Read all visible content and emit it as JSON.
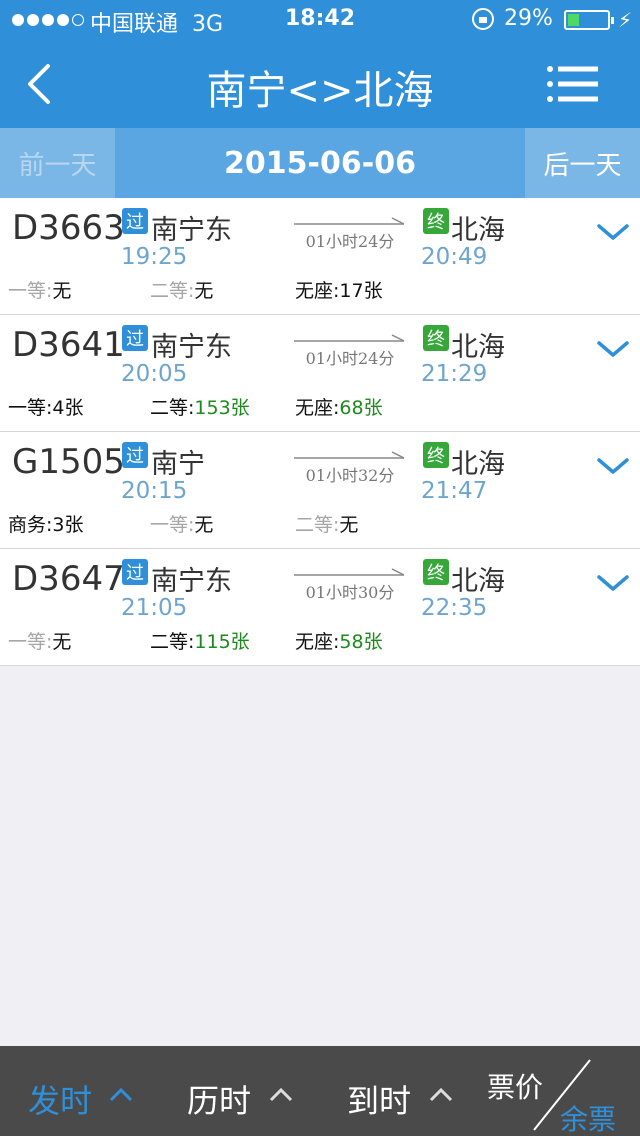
{
  "status_bar": {
    "carrier": "中国联通",
    "network": "3G",
    "time": "18:42",
    "battery_percent": "29%",
    "battery_level": 0.29
  },
  "nav": {
    "title": "南宁<>北海"
  },
  "date_bar": {
    "prev_label": "前一天",
    "date": "2015-06-06",
    "next_label": "后一天"
  },
  "trains": [
    {
      "number": "D3663",
      "pass_badge": "过",
      "from": "南宁东",
      "depart": "19:25",
      "duration": "01小时24分",
      "end_badge": "终",
      "to": "北海",
      "arrive": "20:49",
      "seats": [
        {
          "label": "一等:",
          "value": "无"
        },
        {
          "label": "二等:",
          "value": "无"
        },
        {
          "label": "无座:",
          "value": "17张"
        }
      ]
    },
    {
      "number": "D3641",
      "pass_badge": "过",
      "from": "南宁东",
      "depart": "20:05",
      "duration": "01小时24分",
      "end_badge": "终",
      "to": "北海",
      "arrive": "21:29",
      "seats": [
        {
          "label": "一等:",
          "value": "4张"
        },
        {
          "label": "二等:",
          "value": "153张"
        },
        {
          "label": "无座:",
          "value": "68张"
        }
      ]
    },
    {
      "number": "G1505",
      "pass_badge": "过",
      "from": "南宁",
      "depart": "20:15",
      "duration": "01小时32分",
      "end_badge": "终",
      "to": "北海",
      "arrive": "21:47",
      "seats": [
        {
          "label": "商务:",
          "value": "3张"
        },
        {
          "label": "一等:",
          "value": "无"
        },
        {
          "label": "二等:",
          "value": "无"
        }
      ]
    },
    {
      "number": "D3647",
      "pass_badge": "过",
      "from": "南宁东",
      "depart": "21:05",
      "duration": "01小时30分",
      "end_badge": "终",
      "to": "北海",
      "arrive": "22:35",
      "seats": [
        {
          "label": "一等:",
          "value": "无"
        },
        {
          "label": "二等:",
          "value": "115张"
        },
        {
          "label": "无座:",
          "value": "58张"
        }
      ]
    }
  ],
  "sort_bar": {
    "depart_label": "发时",
    "duration_label": "历时",
    "arrive_label": "到时",
    "price_label": "票价",
    "remaining_label": "余票"
  },
  "colors": {
    "primary": "#2f8fd8",
    "available": "#1d8a1d",
    "unavailable": "#a6a6a6"
  }
}
